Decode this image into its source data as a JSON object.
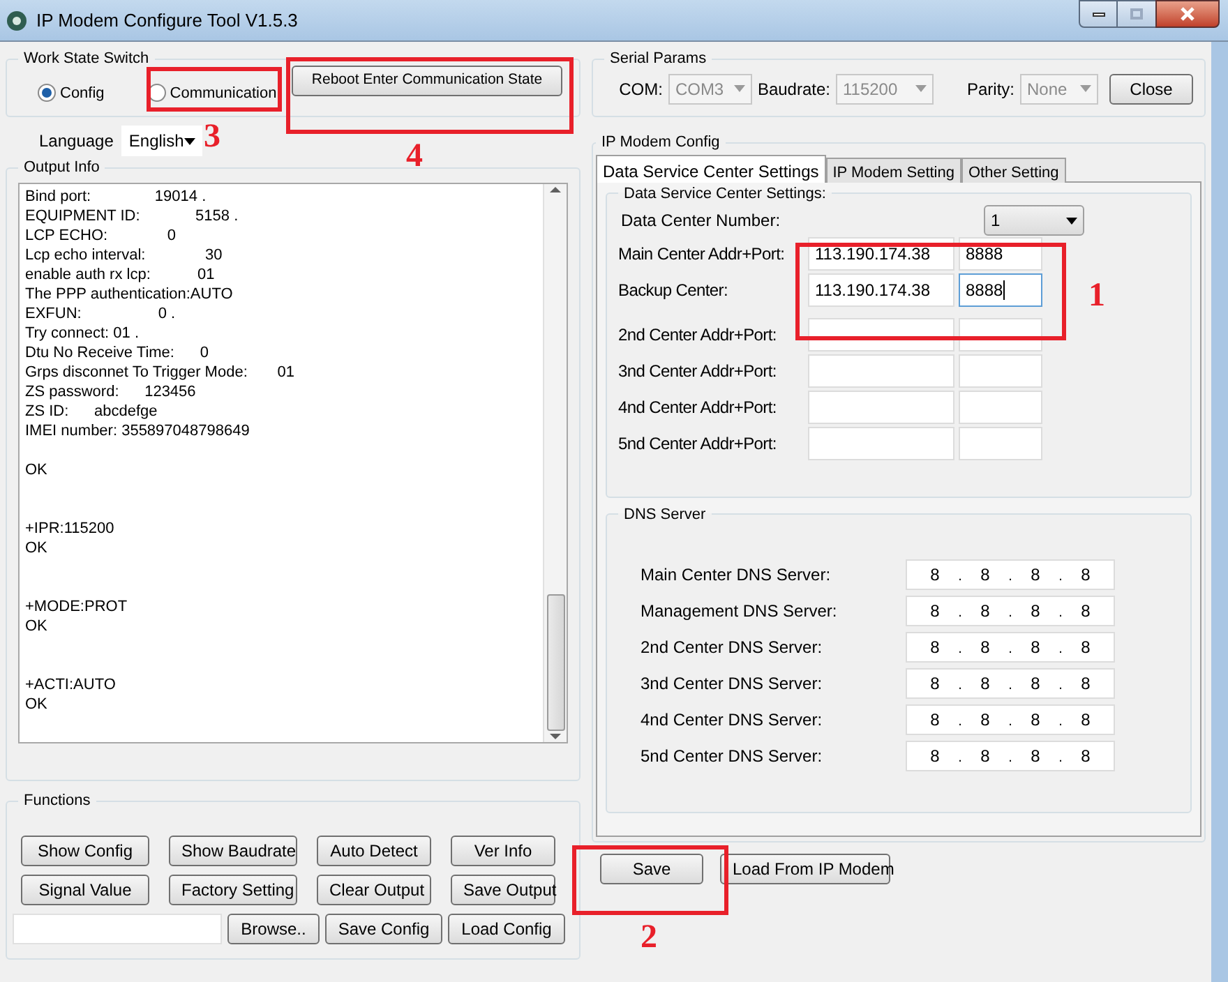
{
  "window": {
    "title": "IP Modem Configure Tool V1.5.3"
  },
  "work_state": {
    "title": "Work State Switch",
    "options": [
      {
        "label": "Config",
        "selected": true
      },
      {
        "label": "Communication",
        "selected": false
      }
    ],
    "button": "Reboot Enter Communication State"
  },
  "language": {
    "label": "Language",
    "value": "English"
  },
  "output": {
    "title": "Output Info",
    "blocks": [
      {
        "lines": [
          "Bind port:               19014 .",
          "EQUIPMENT ID:             5158 .",
          "LCP ECHO:              0",
          "Lcp echo interval:              30",
          "enable auth rx lcp:           01",
          "The PPP authentication:AUTO",
          "EXFUN:                  0 .",
          "Try connect: 01 .",
          "Dtu No Receive Time:      0",
          "Grps disconnet To Trigger Mode:       01",
          "ZS password:      123456",
          "ZS ID:      abcdefge",
          "IMEI number: 355897048798649"
        ]
      },
      {
        "lines": [
          "OK"
        ]
      },
      {
        "lines": [
          "+IPR:115200",
          "OK"
        ]
      },
      {
        "lines": [
          "+MODE:PROT",
          "OK"
        ]
      },
      {
        "lines": [
          "+ACTI:AUTO",
          "OK"
        ]
      }
    ]
  },
  "functions": {
    "title": "Functions",
    "buttons": [
      [
        "Show Config",
        "Show Baudrate",
        "Auto Detect",
        "Ver Info"
      ],
      [
        "Signal Value",
        "Factory Setting",
        "Clear Output",
        "Save Output"
      ]
    ],
    "file_buttons": [
      "Browse..",
      "Save Config",
      "Load Config"
    ]
  },
  "serial": {
    "title": "Serial Params",
    "fields": [
      {
        "label": "COM:",
        "value": "COM3",
        "disabled": true
      },
      {
        "label": "Baudrate:",
        "value": "115200",
        "disabled": true
      },
      {
        "label": "Parity:",
        "value": "None",
        "disabled": true
      }
    ],
    "button": "Close"
  },
  "ip_config": {
    "title": "IP Modem Config",
    "tabs": [
      {
        "label": "Data Service Center Settings",
        "selected": true
      },
      {
        "label": "IP Modem Setting",
        "selected": false
      },
      {
        "label": "Other Setting",
        "selected": false
      }
    ],
    "centers": {
      "title": "Data Service Center Settings:",
      "number_label": "Data Center Number:",
      "number_value": "1",
      "rows": [
        {
          "label": "Main Center Addr+Port:",
          "addr": "113.190.174.38",
          "port": "8888",
          "focused": false
        },
        {
          "label": "Backup Center:",
          "addr": "113.190.174.38",
          "port": "8888",
          "focused": true
        },
        {
          "label": "2nd Center Addr+Port:",
          "focused": false
        },
        {
          "label": "3nd Center Addr+Port:",
          "focused": false
        },
        {
          "label": "4nd Center Addr+Port:",
          "focused": false
        },
        {
          "label": "5nd Center Addr+Port:",
          "focused": false
        }
      ]
    },
    "dns": {
      "title": "DNS Server",
      "separator": ".",
      "rows": [
        {
          "label": "Main Center DNS Server:",
          "octets": [
            "8",
            "8",
            "8",
            "8"
          ]
        },
        {
          "label": "Management DNS Server:",
          "octets": [
            "8",
            "8",
            "8",
            "8"
          ]
        },
        {
          "label": "2nd Center DNS Server:",
          "octets": [
            "8",
            "8",
            "8",
            "8"
          ]
        },
        {
          "label": "3nd Center DNS Server:",
          "octets": [
            "8",
            "8",
            "8",
            "8"
          ]
        },
        {
          "label": "4nd Center DNS Server:",
          "octets": [
            "8",
            "8",
            "8",
            "8"
          ]
        },
        {
          "label": "5nd Center DNS Server:",
          "octets": [
            "8",
            "8",
            "8",
            "8"
          ]
        }
      ]
    },
    "buttons": [
      "Save",
      "Load From IP Modem"
    ]
  },
  "annotations": [
    {
      "number": "1"
    },
    {
      "number": "2"
    },
    {
      "number": "3"
    },
    {
      "number": "4"
    }
  ]
}
